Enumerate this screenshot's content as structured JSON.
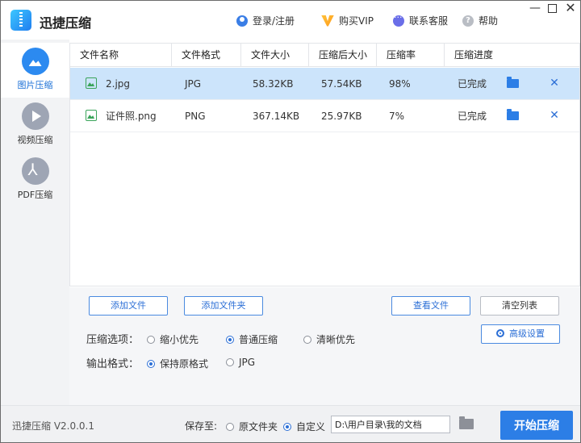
{
  "app": {
    "title": "迅捷压缩",
    "version": "迅捷压缩 V2.0.0.1"
  },
  "header": {
    "login": "登录/注册",
    "vip": "购买VIP",
    "support": "联系客服",
    "help": "帮助"
  },
  "sidebar": {
    "items": [
      {
        "label": "图片压缩",
        "icon": "image-icon",
        "active": true
      },
      {
        "label": "视频压缩",
        "icon": "play-icon",
        "active": false
      },
      {
        "label": "PDF压缩",
        "icon": "pdf-icon",
        "active": false
      }
    ]
  },
  "table": {
    "headers": [
      "文件名称",
      "文件格式",
      "文件大小",
      "压缩后大小",
      "压缩率",
      "压缩进度"
    ],
    "rows": [
      {
        "name": "2.jpg",
        "format": "JPG",
        "size": "58.32KB",
        "compressed": "57.54KB",
        "ratio": "98%",
        "status": "已完成"
      },
      {
        "name": "证件照.png",
        "format": "PNG",
        "size": "367.14KB",
        "compressed": "25.97KB",
        "ratio": "7%",
        "status": "已完成"
      }
    ]
  },
  "actions": {
    "add_file": "添加文件",
    "add_folder": "添加文件夹",
    "view_file": "查看文件",
    "clear_list": "清空列表",
    "advanced": "高级设置"
  },
  "options": {
    "compress_label": "压缩选项：",
    "compress_choices": [
      "缩小优先",
      "普通压缩",
      "清晰优先"
    ],
    "compress_selected": "普通压缩",
    "format_label": "输出格式：",
    "format_choices": [
      "保持原格式",
      "JPG"
    ],
    "format_selected": "保持原格式"
  },
  "footer": {
    "save_to": "保存至:",
    "save_choices": [
      "原文件夹",
      "自定义"
    ],
    "save_selected": "自定义",
    "path": "D:\\用户目录\\我的文档",
    "start": "开始压缩"
  },
  "colors": {
    "accent": "#2c7ee6",
    "selected_row": "#cce4fb",
    "sidebar_bg": "#f2f3f5"
  }
}
